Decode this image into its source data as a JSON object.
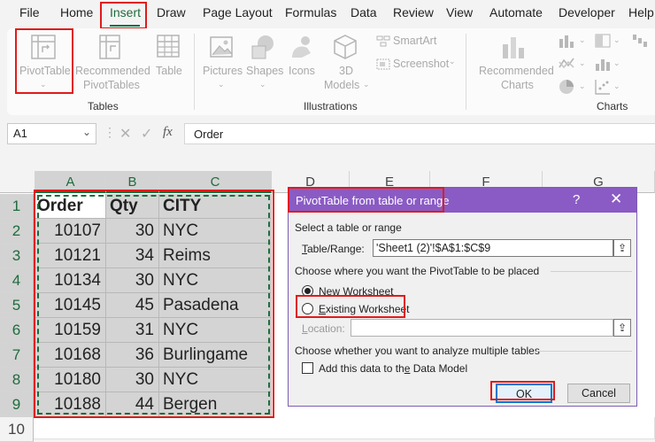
{
  "menu": {
    "tabs": [
      "File",
      "Home",
      "Insert",
      "Draw",
      "Page Layout",
      "Formulas",
      "Data",
      "Review",
      "View",
      "Automate",
      "Developer",
      "Help"
    ],
    "active": "Insert"
  },
  "ribbon": {
    "tables": {
      "pivot": "PivotTable",
      "recommended": "Recommended PivotTables",
      "recommended_l1": "Recommended",
      "recommended_l2": "PivotTables",
      "table": "Table",
      "group": "Tables"
    },
    "illustrations": {
      "pictures": "Pictures",
      "shapes": "Shapes",
      "icons": "Icons",
      "models_l1": "3D",
      "models_l2": "Models",
      "smartart": "SmartArt",
      "screenshot": "Screenshot",
      "group": "Illustrations"
    },
    "charts": {
      "recommended_l1": "Recommended",
      "recommended_l2": "Charts",
      "group": "Charts"
    }
  },
  "formula_bar": {
    "name_box": "A1",
    "fx": "fx",
    "value": "Order"
  },
  "sheet": {
    "columns": [
      "A",
      "B",
      "C",
      "D",
      "E",
      "F",
      "G"
    ],
    "rows": [
      "1",
      "2",
      "3",
      "4",
      "5",
      "6",
      "7",
      "8",
      "9",
      "10"
    ],
    "header": [
      "Order",
      "Qty",
      "CITY"
    ],
    "data": [
      [
        "10107",
        "30",
        "NYC"
      ],
      [
        "10121",
        "34",
        "Reims"
      ],
      [
        "10134",
        "30",
        "NYC"
      ],
      [
        "10145",
        "45",
        "Pasadena"
      ],
      [
        "10159",
        "31",
        "NYC"
      ],
      [
        "10168",
        "36",
        "Burlingame"
      ],
      [
        "10180",
        "30",
        "NYC"
      ],
      [
        "10188",
        "44",
        "Bergen"
      ]
    ]
  },
  "dialog": {
    "title": "PivotTable from table or range",
    "help": "?",
    "close": "✕",
    "select_label": "Select a table or range",
    "range_label": "Table/Range:",
    "range_value": "'Sheet1 (2)'!$A$1:$C$9",
    "place_label": "Choose where you want the PivotTable to be placed",
    "new_ws": "New Worksheet",
    "existing_ws": "Existing Worksheet",
    "location_label": "Location:",
    "location_value": "",
    "analyze_label": "Choose whether you want to analyze multiple tables",
    "data_model": "Add this data to the Data Model",
    "ok": "OK",
    "cancel": "Cancel",
    "picker_icon": "range-picker-icon"
  },
  "colors": {
    "accent_green": "#1e6c3c",
    "dialog_purple": "#8a5bc4",
    "highlight_red": "#e01b1b"
  }
}
